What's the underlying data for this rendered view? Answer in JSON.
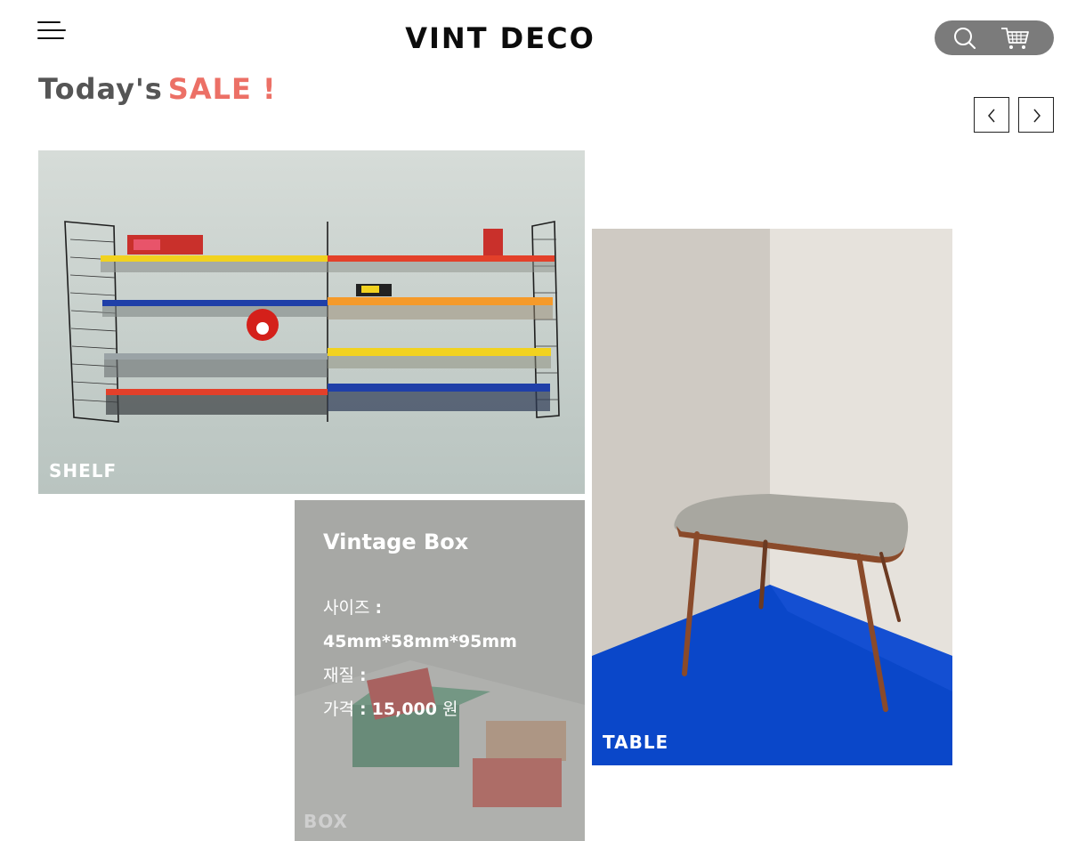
{
  "header": {
    "logo": "VINT DECO",
    "menu_icon": "hamburger-menu-icon",
    "search_icon": "search-icon",
    "cart_icon": "cart-icon",
    "tools_bg_color": "#7b7b7b"
  },
  "sale": {
    "title_prefix": "Today's",
    "title_highlight": "SALE !",
    "highlight_color": "#ec7066",
    "prev_icon": "chevron-left-icon",
    "next_icon": "chevron-right-icon"
  },
  "products": {
    "shelf": {
      "category": "SHELF"
    },
    "table": {
      "category": "TABLE"
    },
    "box": {
      "category": "BOX",
      "name": "Vintage Box",
      "size_label": "사이즈",
      "size_value": "45mm*58mm*95mm",
      "material_label": "재질",
      "material_value": "",
      "price_label": "가격",
      "price_value": "15,000",
      "currency": "원"
    }
  }
}
